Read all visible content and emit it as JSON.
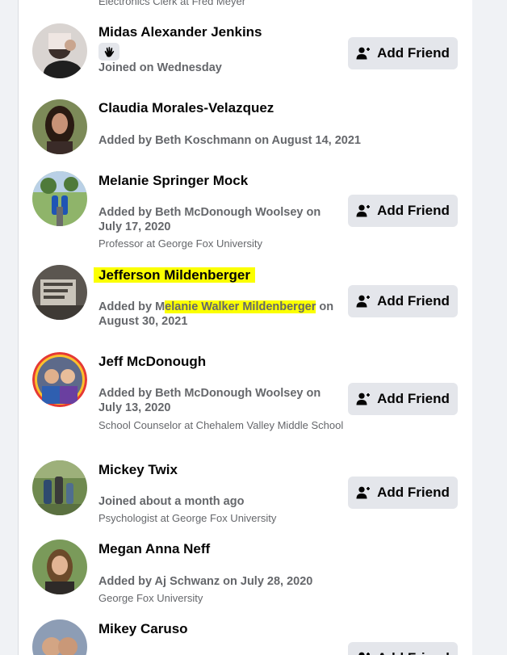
{
  "top_partial": {
    "subtitle": "Electronics Clerk at Fred Meyer"
  },
  "add_friend_label": "Add Friend",
  "members": [
    {
      "name": "Midas Alexander Jenkins",
      "detail": "Joined on Wednesday",
      "wave": true
    },
    {
      "name": "Claudia Morales-Velazquez",
      "detail": "Added by Beth Koschmann on August 14, 2021"
    },
    {
      "name": "Melanie Springer Mock",
      "detail": "Added by Beth McDonough Woolsey on July 17, 2020",
      "sub": "Professor at George Fox University"
    },
    {
      "name": "Jefferson Mildenberger",
      "detail_parts": {
        "before": "Added by M",
        "highlight": "elanie Walker Mildenberger",
        "after": " on August 30, 2021"
      }
    },
    {
      "name": "Jeff McDonough",
      "detail": "Added by Beth McDonough Woolsey on July 13, 2020",
      "sub": "School Counselor at Chehalem Valley Middle School"
    },
    {
      "name": "Mickey Twix",
      "detail": "Joined about a month ago",
      "sub": "Psychologist at George Fox University"
    },
    {
      "name": "Megan Anna Neff",
      "detail": "Added by Aj Schwanz on July 28, 2020",
      "sub": "George Fox University"
    },
    {
      "name": "Mikey Caruso"
    }
  ],
  "colors": {
    "highlight": "#fbff00",
    "button_bg": "#e4e6eb",
    "secondary_text": "#65676b"
  }
}
